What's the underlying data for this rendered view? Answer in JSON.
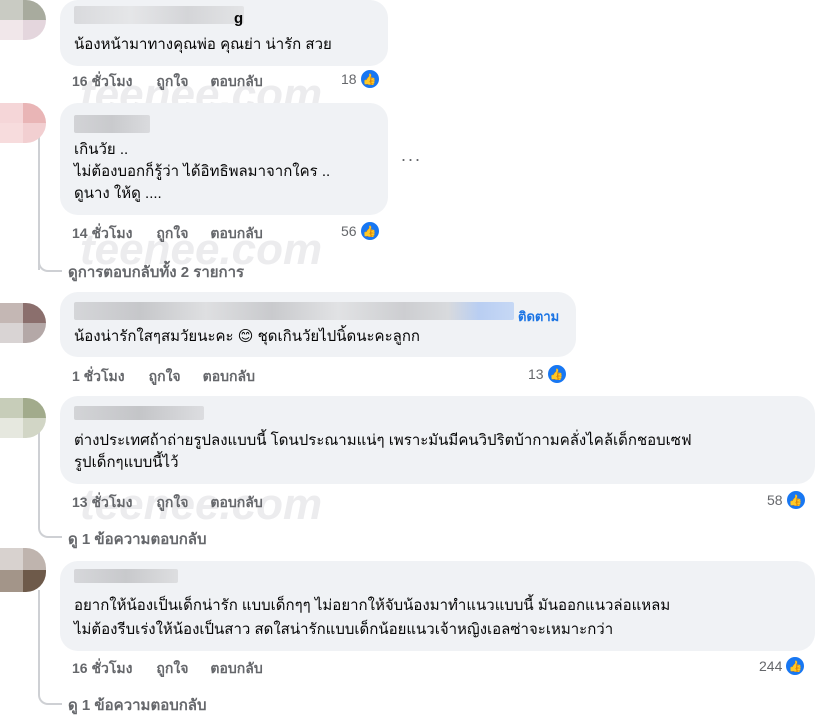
{
  "comments": [
    {
      "text": [
        "น้องหน้ามาทางคุณพ่อ คุณย่า น่ารัก สวย"
      ],
      "time": "16 ชั่วโมง",
      "like": "ถูกใจ",
      "reply": "ตอบกลับ",
      "reactions": "18",
      "name_fragment": "g"
    },
    {
      "text": [
        "เกินวัย ..",
        "ไม่ต้องบอกก็รู้ว่า ได้อิทธิพลมาจากใคร ..",
        "ดูนาง ให้ดู ...."
      ],
      "time": "14 ชั่วโมง",
      "like": "ถูกใจ",
      "reply": "ตอบกลับ",
      "reactions": "56",
      "more": "..."
    },
    {
      "text": [
        "น้องน่ารักใสๆสมวัยนะคะ 😊 ชุดเกินวัยไปนิ้ดนะคะลูกก"
      ],
      "time": "1 ชั่วโมง",
      "like": "ถูกใจ",
      "reply": "ตอบกลับ",
      "reactions": "13",
      "follow": "ติดตาม"
    },
    {
      "text": [
        "ต่างประเทศถ้าถ่ายรูปลงแบบนี้ โดนประณามแน่ๆ เพราะมันมีคนวิปริตบ้ากามคลั่งไคล้เด็กชอบเซฟ",
        "รูปเด็กๆแบบนี้ไว้"
      ],
      "time": "13 ชั่วโมง",
      "like": "ถูกใจ",
      "reply": "ตอบกลับ",
      "reactions": "58"
    },
    {
      "text": [
        "อยากให้น้องเป็นเด็กน่ารัก แบบเด็กๆๆ ไม่อยากให้จับน้องมาทำแนวแบบนี้ มันออกแนวล่อแหลม",
        "ไม่ต้องรีบเร่งให้น้องเป็นสาว สดใสน่ารักแบบเด็กน้อยแนวเจ้าหญิงเอลซ่าจะเหมาะกว่า"
      ],
      "time": "16 ชั่วโมง",
      "like": "ถูกใจ",
      "reply": "ตอบกลับ",
      "reactions": "244"
    }
  ],
  "view_replies": {
    "all_2": "ดูการตอบกลับทั้ง 2 รายการ",
    "one_a": "ดู 1 ข้อความตอบกลับ",
    "one_b": "ดู 1 ข้อความตอบกลับ"
  },
  "watermark": "teenee.com",
  "icons": {
    "like": "thumbs-up-icon",
    "more": "more-dots-icon"
  },
  "colors": {
    "accent": "#1877f2",
    "bubble": "#f0f2f5",
    "meta": "#65676b"
  }
}
